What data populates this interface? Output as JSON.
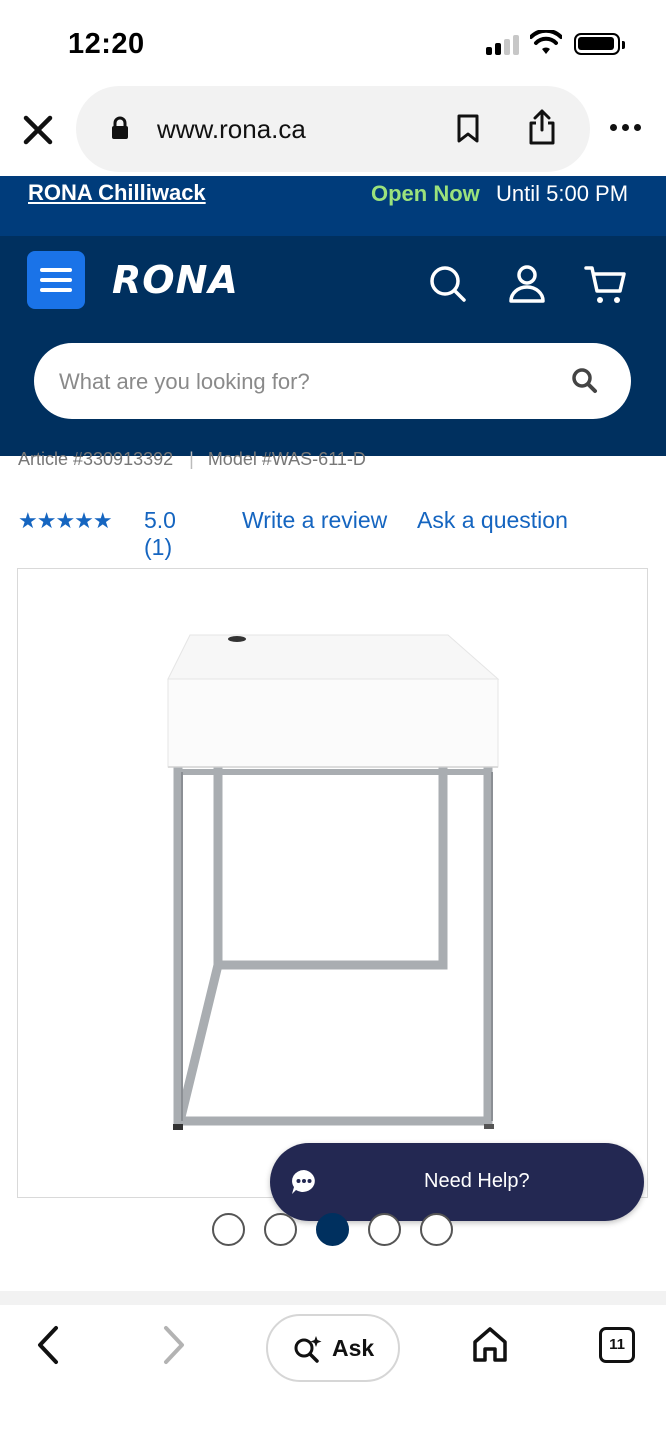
{
  "status_bar": {
    "time": "12:20"
  },
  "browser": {
    "url": "www.rona.ca",
    "icons": [
      "close-icon",
      "lock-icon",
      "bookmark-icon",
      "share-icon",
      "more-icon"
    ]
  },
  "store_bar": {
    "store_name": "RONA Chilliwack",
    "open_status": "Open Now",
    "hours": "Until 5:00 PM"
  },
  "header": {
    "logo_text": "RONA",
    "search_placeholder": "What are you looking for?",
    "icons": [
      "menu-icon",
      "search-icon",
      "account-icon",
      "cart-icon"
    ]
  },
  "product": {
    "article": "Article #330913392",
    "model": "Model #WAS-611-D",
    "stars": "★★★★★",
    "rating": "5.0 (1)",
    "write_review": "Write a review",
    "ask_question": "Ask a question"
  },
  "gallery": {
    "dot_count": 5,
    "active_index": 2
  },
  "help": {
    "label": "Need Help?"
  },
  "toolbar": {
    "ask_label": "Ask",
    "tab_count": "11"
  },
  "colors": {
    "brand_navy": "#00305f",
    "store_bar": "#003c7b",
    "menu_blue": "#1a73e8",
    "open_green": "#9be27c",
    "link_blue": "#1565c0",
    "help_bg": "#232852"
  }
}
